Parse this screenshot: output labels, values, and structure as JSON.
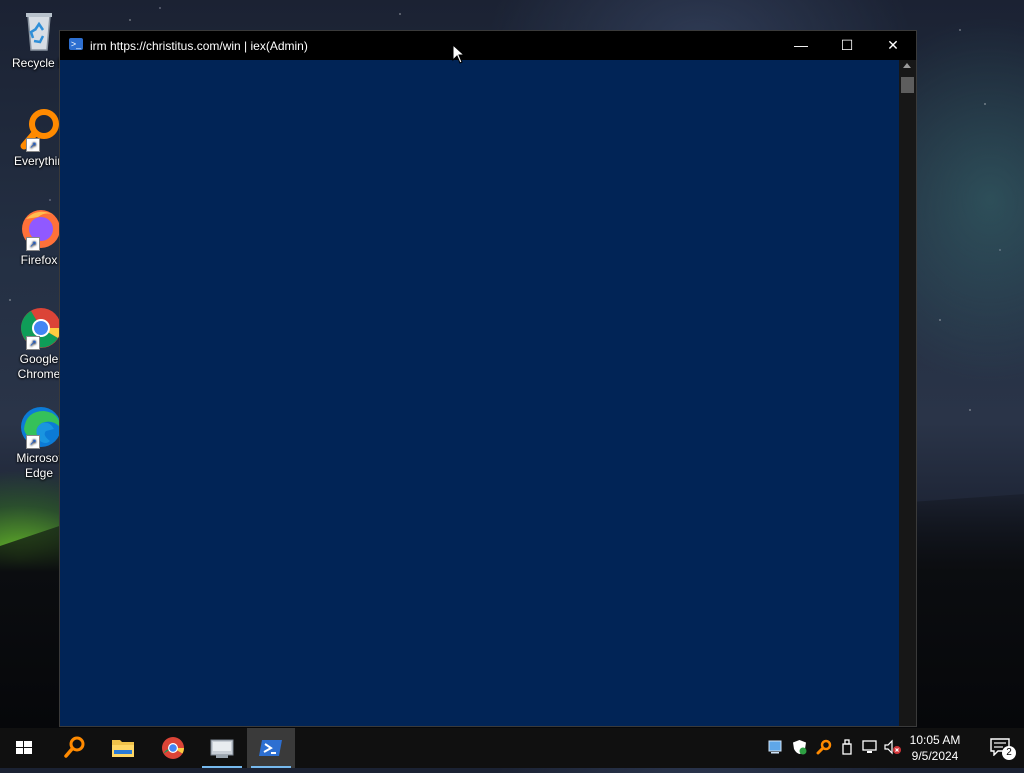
{
  "desktop": {
    "icons": [
      {
        "label": "Recycle B",
        "icon": "recycle-bin-icon"
      },
      {
        "label": "Everythin",
        "icon": "everything-search-icon"
      },
      {
        "label": "Firefox",
        "icon": "firefox-icon"
      },
      {
        "label": "Google Chrome",
        "icon": "chrome-icon"
      },
      {
        "label": "Microsof Edge",
        "icon": "edge-icon"
      }
    ]
  },
  "window": {
    "title": "irm https://christitus.com/win | iex(Admin)",
    "minimize_glyph": "—",
    "maximize_glyph": "☐",
    "close_glyph": "✕",
    "console_bg": "#012456"
  },
  "taskbar": {
    "items": [
      "start-icon",
      "everything-search-icon",
      "file-explorer-icon",
      "chrome-icon",
      "unknown-app-icon",
      "powershell-icon"
    ],
    "clock_time": "10:05 AM",
    "clock_date": "9/5/2024",
    "notification_count": "2"
  }
}
